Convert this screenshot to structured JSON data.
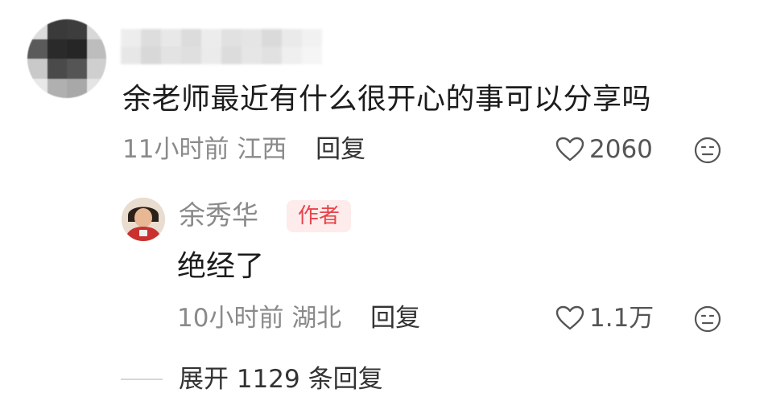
{
  "comment": {
    "text": "余老师最近有什么很开心的事可以分享吗",
    "time": "11小时前",
    "location": "江西",
    "reply_label": "回复",
    "likes": "2060",
    "icons": {
      "like": "heart-outline-icon",
      "dislike": "neutral-face-icon"
    }
  },
  "reply": {
    "author": "余秀华",
    "badge": "作者",
    "text": "绝经了",
    "time": "10小时前",
    "location": "湖北",
    "reply_label": "回复",
    "likes": "1.1万"
  },
  "expand": {
    "label": "展开 1129 条回复"
  },
  "colors": {
    "badge_text": "#e8434a",
    "badge_bg": "#fdeceb",
    "meta": "#8a8a8a"
  }
}
